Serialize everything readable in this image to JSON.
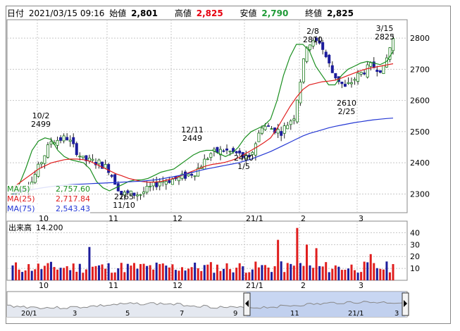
{
  "header": {
    "date_label": "日付",
    "datetime": "2021/03/15 09:16",
    "open_label": "始値",
    "open_value": "2,801",
    "high_label": "高値",
    "high_value": "2,825",
    "low_label": "安値",
    "low_value": "2,790",
    "close_label": "終値",
    "close_value": "2,825"
  },
  "colors": {
    "high": "#e6000f",
    "low": "#1e9a36",
    "up_candle": "#ffffff",
    "down_candle": "#1c1c9c",
    "ma5": "#1b8f20",
    "ma25": "#e01e1e",
    "ma75": "#2538d4",
    "grid": "#c8c8c8",
    "volume_up": "#e01e1e",
    "volume_down": "#1c1c9c",
    "navigator_fill": "#b5c8ee"
  },
  "moving_averages": [
    {
      "label": "MA(5)",
      "value": "2,757.60",
      "color": "#1b8f20"
    },
    {
      "label": "MA(25)",
      "value": "2,717.84",
      "color": "#e01e1e"
    },
    {
      "label": "MA(75)",
      "value": "2,543.43",
      "color": "#2538d4"
    }
  ],
  "volume": {
    "title": "出来高",
    "value": "14.200",
    "y_ticks": [
      "40",
      "30",
      "20",
      "10"
    ]
  },
  "chart_data": {
    "type": "candlestick",
    "price_axis_ticks": [
      2800,
      2700,
      2600,
      2500,
      2400,
      2300
    ],
    "ylim": [
      2240,
      2850
    ],
    "x_tick_labels": [
      "10",
      "11",
      "12",
      "21/1",
      "2",
      "3"
    ],
    "annotations": [
      {
        "date": "10/2",
        "price": "2499",
        "type": "high"
      },
      {
        "date": "11/10",
        "price": "2265",
        "type": "low"
      },
      {
        "date": "12/11",
        "price": "2449",
        "type": "high"
      },
      {
        "date": "1/5",
        "price": "2400",
        "type": "low"
      },
      {
        "date": "2/8",
        "price": "2810",
        "type": "high"
      },
      {
        "date": "2/25",
        "price": "2610",
        "type": "low"
      },
      {
        "date": "3/15",
        "price": "2825",
        "type": "high"
      }
    ],
    "series": [
      {
        "name": "MA(5)",
        "values": [
          2300,
          2330,
          2380,
          2440,
          2470,
          2480,
          2475,
          2440,
          2420,
          2410,
          2405,
          2400,
          2380,
          2340,
          2320,
          2310,
          2320,
          2330,
          2340,
          2345,
          2345,
          2350,
          2360,
          2370,
          2375,
          2380,
          2395,
          2410,
          2425,
          2435,
          2440,
          2440,
          2430,
          2420,
          2430,
          2450,
          2480,
          2500,
          2510,
          2520,
          2540,
          2600,
          2680,
          2740,
          2780,
          2780,
          2760,
          2710,
          2680,
          2650,
          2650,
          2680,
          2700,
          2710,
          2720,
          2725,
          2720,
          2715,
          2725,
          2757.6
        ]
      },
      {
        "name": "MA(25)",
        "values": [
          2320,
          2335,
          2350,
          2365,
          2380,
          2390,
          2400,
          2405,
          2410,
          2412,
          2412,
          2410,
          2405,
          2395,
          2385,
          2375,
          2365,
          2358,
          2350,
          2345,
          2340,
          2338,
          2338,
          2340,
          2345,
          2350,
          2358,
          2366,
          2374,
          2382,
          2390,
          2395,
          2398,
          2402,
          2408,
          2416,
          2428,
          2440,
          2452,
          2465,
          2480,
          2510,
          2545,
          2580,
          2610,
          2635,
          2650,
          2655,
          2660,
          2662,
          2665,
          2672,
          2680,
          2688,
          2696,
          2702,
          2706,
          2710,
          2714,
          2717.84
        ]
      },
      {
        "name": "MA(75)",
        "values": [
          2300,
          2305,
          2310,
          2314,
          2318,
          2321,
          2324,
          2326,
          2328,
          2330,
          2331,
          2332,
          2333,
          2334,
          2335,
          2336,
          2337,
          2338,
          2339,
          2340,
          2341,
          2343,
          2345,
          2348,
          2352,
          2356,
          2360,
          2365,
          2370,
          2375,
          2380,
          2384,
          2388,
          2392,
          2396,
          2400,
          2406,
          2412,
          2420,
          2428,
          2436,
          2446,
          2456,
          2466,
          2476,
          2486,
          2494,
          2500,
          2506,
          2512,
          2517,
          2521,
          2525,
          2529,
          2532,
          2535,
          2538,
          2540,
          2542,
          2543.43
        ]
      }
    ]
  },
  "navigator": {
    "x_labels": [
      "20/1",
      "3",
      "5",
      "7",
      "9",
      "11",
      "21/1",
      "3"
    ]
  }
}
